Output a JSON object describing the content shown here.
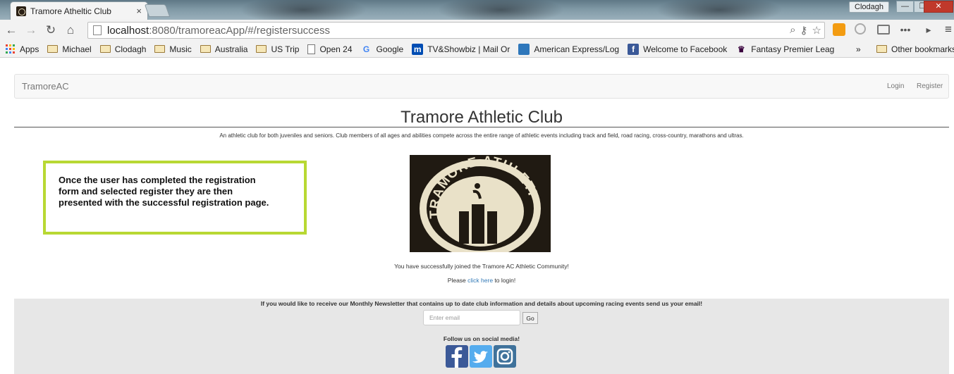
{
  "browser": {
    "tab_title": "Tramore Atheltic Club",
    "tab_close": "×",
    "profile_name": "Clodagh",
    "window_controls": {
      "minimize": "—",
      "maximize": "❐",
      "close": "✕"
    },
    "nav": {
      "back": "←",
      "forward": "→",
      "reload": "↻",
      "home": "⌂"
    },
    "url_host": "localhost",
    "url_rest": ":8080/tramoreacApp/#/registersuccess",
    "omnibox_icons": {
      "zoom": "⌕",
      "key": "⚷",
      "star": "☆"
    },
    "menu": "≡",
    "bookmarks_overflow": "»",
    "bookmarks": [
      {
        "label": "Apps",
        "icon": "apps-grid-icon"
      },
      {
        "label": "Michael",
        "icon": "folder-icon"
      },
      {
        "label": "Clodagh",
        "icon": "folder-icon"
      },
      {
        "label": "Music",
        "icon": "folder-icon"
      },
      {
        "label": "Australia",
        "icon": "folder-icon"
      },
      {
        "label": "US Trip",
        "icon": "folder-icon"
      },
      {
        "label": "Open 24",
        "icon": "page-icon"
      },
      {
        "label": "Google",
        "icon": "google-icon"
      },
      {
        "label": "TV&Showbiz | Mail Or",
        "icon": "mail-online-icon"
      },
      {
        "label": "American Express/Log",
        "icon": "amex-icon"
      },
      {
        "label": "Welcome to Facebook",
        "icon": "facebook-icon"
      },
      {
        "label": "Fantasy Premier Leag",
        "icon": "premier-league-icon"
      },
      {
        "label": "Other bookmarks",
        "icon": "folder-icon"
      }
    ]
  },
  "navbar": {
    "brand": "TramoreAC",
    "login": "Login",
    "register": "Register"
  },
  "header": {
    "title": "Tramore Athletic Club",
    "intro": "An athletic club for both juveniles and seniors. Club members of all ages and abilities compete across the entire range of athletic events including track and field, road racing, cross-country, marathons and ultras."
  },
  "callout": {
    "text": "Once the user has completed the registration form and selected register they are then presented with the successful registration page."
  },
  "logo": {
    "text": "TRAMORE ATHLETIC CLUB"
  },
  "success": {
    "message": "You have successfully joined the Tramore AC Athletic Community!",
    "login_prefix": "Please ",
    "login_link": "click here",
    "login_suffix": " to login!"
  },
  "footer": {
    "newsletter": "If you would like to receive our Monthly Newsletter that contains up to date club information and details about upcoming racing events send us your email!",
    "email_placeholder": "Enter email",
    "go_label": "Go",
    "follow": "Follow us on social media!",
    "social": [
      {
        "name": "facebook",
        "glyph": "f",
        "color": "#3b5998"
      },
      {
        "name": "twitter",
        "glyph": "t",
        "color": "#55acee"
      },
      {
        "name": "instagram",
        "glyph": "◎",
        "color": "#3f729b"
      }
    ]
  },
  "colors": {
    "callout_border": "#b8d833",
    "link": "#337ab7",
    "footer_bg": "#e7e7e7"
  }
}
